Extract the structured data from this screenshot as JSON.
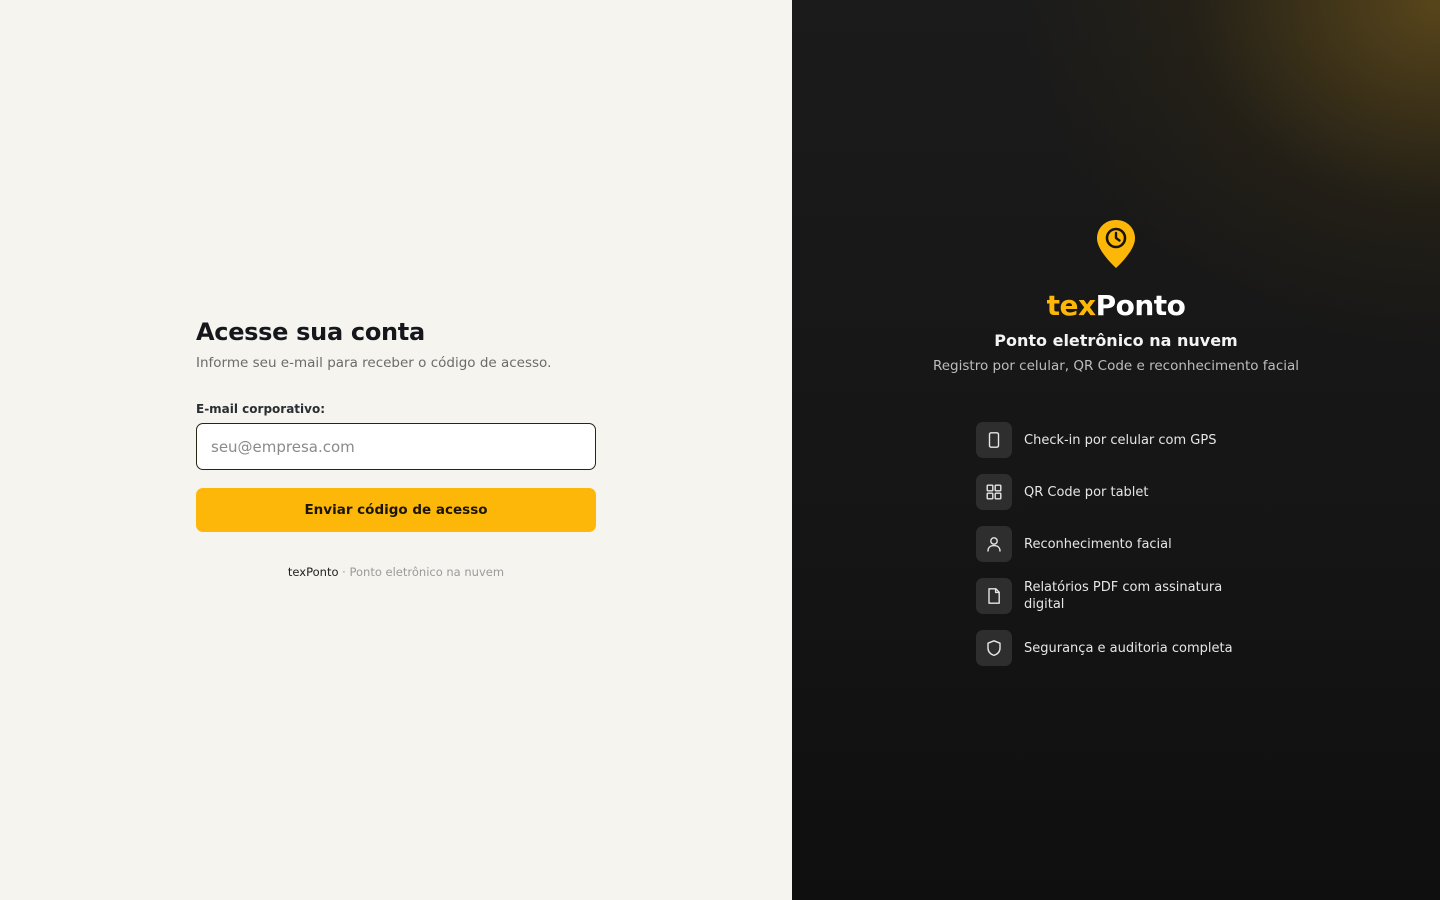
{
  "login": {
    "title": "Acesse sua conta",
    "subtitle": "Informe seu e-mail para receber o código de acesso.",
    "email_label": "E-mail corporativo:",
    "email_placeholder": "seu@empresa.com",
    "email_value": "",
    "submit_label": "Enviar código de acesso",
    "footer_brand": "texPonto",
    "footer_separator": " · ",
    "footer_text": "Ponto eletrônico na nuvem"
  },
  "brand": {
    "logo_icon": "location-pin-clock-icon",
    "name_part1": "tex",
    "name_part2": "Ponto",
    "tagline": "Ponto eletrônico na nuvem",
    "description": "Registro por celular, QR Code e reconhecimento facial"
  },
  "features": [
    {
      "icon": "smartphone-icon",
      "label": "Check-in por celular com GPS"
    },
    {
      "icon": "qr-grid-icon",
      "label": "QR Code por tablet"
    },
    {
      "icon": "user-icon",
      "label": "Reconhecimento facial"
    },
    {
      "icon": "document-icon",
      "label": "Relatórios PDF com assinatura digital"
    },
    {
      "icon": "shield-icon",
      "label": "Segurança e auditoria completa"
    }
  ],
  "colors": {
    "accent": "#fdb708",
    "left_background": "#f5f4ef",
    "right_background": "#151515"
  }
}
